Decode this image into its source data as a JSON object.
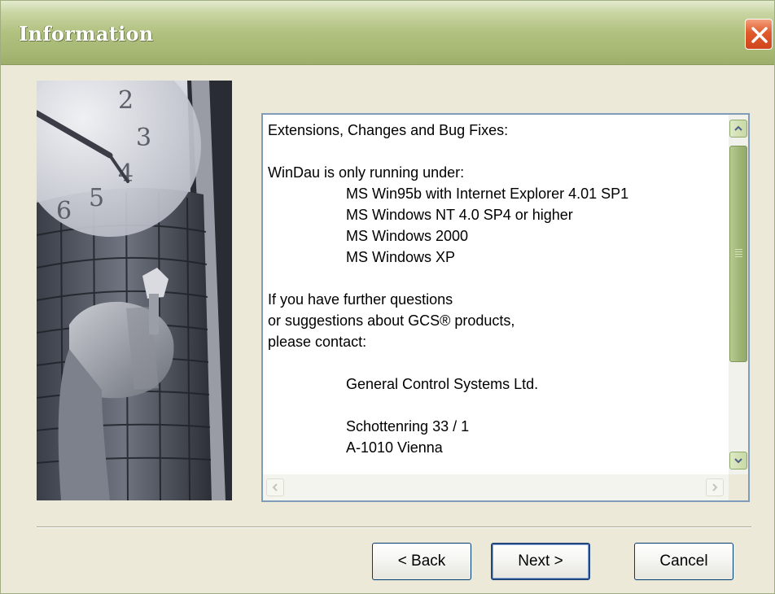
{
  "window": {
    "title": "Information"
  },
  "content": {
    "lines": [
      "Extensions, Changes and Bug Fixes:",
      "",
      "WinDau is only running under:",
      "MS Win95b with Internet Explorer 4.01 SP1",
      "MS Windows NT 4.0 SP4 or higher",
      "MS Windows 2000",
      "MS Windows XP",
      "",
      "If you have further questions",
      "or suggestions about GCS® products,",
      "please contact:",
      "",
      "General Control Systems Ltd.",
      "",
      "Schottenring 33 / 1",
      "A-1010 Vienna"
    ]
  },
  "side_image": {
    "clock_numerals": [
      "2",
      "3",
      "4",
      "5",
      "6"
    ]
  },
  "buttons": {
    "back": "< Back",
    "next": "Next >",
    "cancel": "Cancel"
  },
  "icons": {
    "close": "close-x-icon",
    "scroll_up": "arrow-up-icon",
    "scroll_down": "arrow-down-icon",
    "scroll_left": "arrow-left-icon",
    "scroll_right": "arrow-right-icon"
  },
  "colors": {
    "titlebar": "#b1c17f",
    "close": "#e05a2c",
    "dialog_bg": "#ece9d8"
  }
}
